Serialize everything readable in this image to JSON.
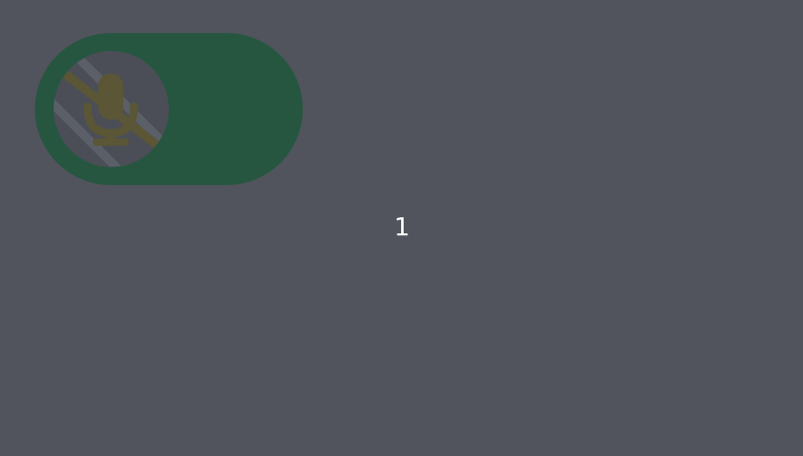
{
  "toggle": {
    "state": "off",
    "icon": "microphone-muted-icon",
    "track_color": "#265640",
    "knob_color": "#4b4e56",
    "icon_color": "#5a5636"
  },
  "counter": {
    "value": "1"
  },
  "colors": {
    "background": "#51545c",
    "counter_text": "#ffffff"
  }
}
